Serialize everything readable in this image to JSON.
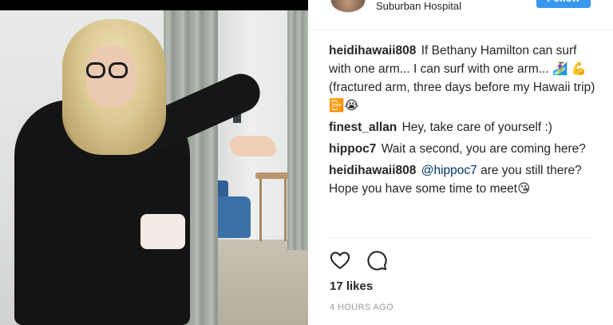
{
  "post": {
    "header": {
      "location": "Suburban Hospital",
      "follow_label": "Follow"
    },
    "comments": [
      {
        "username": "heidihawaii808",
        "text": "If Bethany Hamilton can surf with one arm... I can surf with one arm... 🏄‍♀️ 💪 (fractured arm, three days before my Hawaii trip) 📴😭"
      },
      {
        "username": "finest_allan",
        "text": "Hey, take care of yourself :)"
      },
      {
        "username": "hippoc7",
        "text": "Wait a second, you are coming here?"
      },
      {
        "username": "heidihawaii808",
        "mention": "@hippoc7",
        "text": "are you still there? Hope you have some time to meet😘"
      }
    ],
    "actions": {
      "like_icon": "heart-icon",
      "comment_icon": "comment-icon"
    },
    "likes": "17 likes",
    "timestamp": "4 HOURS AGO"
  },
  "colors": {
    "follow_button": "#3897f0",
    "text": "#262626",
    "muted": "#999999",
    "mention": "#003569"
  }
}
